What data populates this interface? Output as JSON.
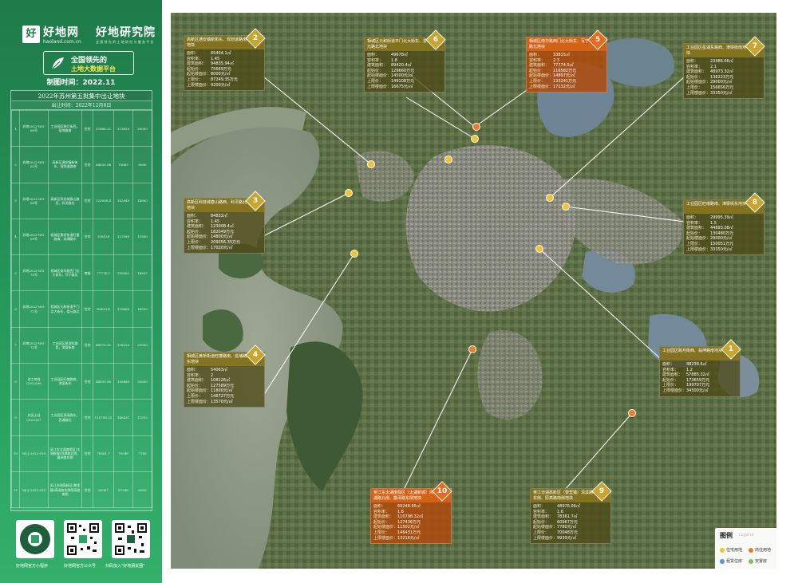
{
  "brand": {
    "logo_char": "好",
    "name": "好地网",
    "domain": "haoland.com.cn",
    "research": "好地研究院",
    "research_sub": "全 国 领 先 的 土 地 研 究 与 服 务 平 台"
  },
  "platform": {
    "line1": "全国领先的",
    "line2": "土地大数据平台"
  },
  "make_time": "制图时间：2022.11",
  "table": {
    "title": "2022年苏州第五批集中出让地块",
    "subtitle": "出让时间：2022年12月8日",
    "rows": [
      [
        "1",
        "苏地2022-WG-60号",
        "工业园区跨月街西，翁坤路南",
        "住宅",
        "57888.32",
        "173659",
        "30000"
      ],
      [
        "2",
        "苏地2022-WG-62号",
        "高新区通安镇新街东，规划道路南",
        "住宅",
        "84835.94",
        "75669",
        "8000"
      ],
      [
        "3",
        "苏地2022-WG-68号",
        "高新区科技城春山路西，科灵路北",
        "住宅",
        "123008.4",
        "182049",
        "14800"
      ],
      [
        "4",
        "苏地2022-WG-69号",
        "相城区黄桥街道旺蓬路南，巡埔路东",
        "住宅",
        "108126",
        "127589",
        "11800"
      ],
      [
        "5",
        "苏地2022-WG-70号",
        "相城区南华路西门北大街东，写宁路北",
        "商服",
        "77774.5",
        "116582",
        "14897"
      ],
      [
        "6",
        "苏地2022-WG-71号",
        "相城区元和街道平门北大街东，爱元路北",
        "住宅",
        "89420.4",
        "129660",
        "14500"
      ],
      [
        "7",
        "苏地2022-WG-72号",
        "工业园区星湖东路西，津梁街南",
        "住宅",
        "48973.32",
        "136223",
        "29000"
      ],
      [
        "8",
        "苏工地块(2022)06",
        "工业园区旺墩路南，津梁街东",
        "住宅",
        "44893.08",
        "130480",
        "30000"
      ],
      [
        "9",
        "苏吴土挂(2022)07",
        "工业园区扬清路东，西浦路北",
        "住宅",
        "110798.32",
        "146431",
        "11502"
      ],
      [
        "10",
        "WJ-J-2022-019",
        "吴江东太湖度假区(太湖新城)鸿湖路北侧，震泽路东侧",
        "住宅",
        "78361.7",
        "70048",
        "7780"
      ],
      [
        "11",
        "WJ-J-2022-018",
        "吴江汾湖高新区(黎里镇)清溪路东侧原高路南侧",
        "住宅",
        "60967",
        "87248",
        "8000"
      ]
    ]
  },
  "qr": [
    {
      "label": "好地网官方小程序"
    },
    {
      "label": "好地网官方公众号"
    },
    {
      "label": "扫码加入\"好地朋友圈\""
    }
  ],
  "parcels": [
    {
      "num": "1",
      "type": "residential",
      "title": "工业园区跨月街西、翁坤路南地块",
      "area": "48238.6㎡",
      "far": "1.2",
      "building": "57885.32㎡",
      "start_price": "173659万元",
      "cap_price": "199707万元",
      "cap_floor": "34500元/㎡"
    },
    {
      "num": "2",
      "type": "residential",
      "title": "高新区通安镇新街东、规划道路南地块",
      "area": "65404.1㎡",
      "far": "1.45",
      "building": "94835.94㎡",
      "start_price": "75669万元",
      "cap_price": "87249.35万元",
      "cap_floor": "9200元/㎡",
      "floor_price": "8000元/㎡"
    },
    {
      "num": "3",
      "type": "residential",
      "title": "高新区科技城春山路西、科灵路北地块",
      "area": "84832㎡",
      "far": "1.45",
      "building": "123008.4㎡",
      "start_price": "182049万元",
      "cap_price": "209356.35万元",
      "cap_floor": "17020元/㎡",
      "floor_price": "14800元/㎡"
    },
    {
      "num": "4",
      "type": "residential",
      "title": "相城区黄桥街道旺蓬路南、巡埔路东地块",
      "area": "54063㎡",
      "far": "2",
      "building": "108126㎡",
      "start_price": "127589万元",
      "cap_price": "146727万元",
      "cap_floor": "13570元/㎡",
      "floor_price": "11800元/㎡"
    },
    {
      "num": "5",
      "type": "commercial",
      "title": "相城区南华路西门北大街东、写宁路北地块",
      "area": "33815㎡",
      "far": "2.3",
      "building": "77774.5㎡",
      "start_price": "116582万元",
      "cap_price": "133241万元",
      "cap_floor": "17132元/㎡",
      "floor_price": "14897元/㎡"
    },
    {
      "num": "6",
      "type": "residential",
      "title": "相城区元和街道平门北大街东、爱元路北地块",
      "area": "49678㎡",
      "far": "1.8",
      "building": "89420.4㎡",
      "start_price": "129660万元",
      "cap_price": "149108万元",
      "cap_floor": "16675元/㎡",
      "floor_price": "14500元/㎡"
    },
    {
      "num": "7",
      "type": "residential",
      "title": "工业园区星湖东路西、津梁街南地块",
      "area": "23486.66㎡",
      "far": "2.1",
      "building": "48973.32㎡",
      "start_price": "136223万元",
      "cap_price": "156656万元",
      "cap_floor": "33350元/㎡",
      "floor_price": "29000元/㎡"
    },
    {
      "num": "8",
      "type": "residential",
      "title": "工业园区旺墩路南、津梁街东地块",
      "area": "29995.39㎡",
      "far": "1.5",
      "building": "44893.08㎡",
      "start_price": "130480万元",
      "cap_price": "150051万元",
      "cap_floor": "33350元/㎡",
      "floor_price": "29000元/㎡"
    },
    {
      "num": "9",
      "type": "residential",
      "title": "吴江汾湖高新区（黎里镇）清溪路东侧、原高路南侧地块",
      "area": "48976.06㎡",
      "far": "1.6",
      "building": "78361.7㎡",
      "start_price": "60967万元",
      "cap_price": "70048万元",
      "cap_floor": "9939元/㎡",
      "floor_price": "7780元/㎡"
    },
    {
      "num": "10",
      "type": "commercial",
      "title": "吴江东太湖度假区（太湖新城）鸿湖路北侧、震泽路东侧地块",
      "area": "69248.95㎡",
      "far": "1.6",
      "building": "110798.32㎡",
      "start_price": "127436万元",
      "cap_price": "146431万元",
      "cap_floor": "13216元/㎡",
      "floor_price": "11502元/㎡"
    }
  ],
  "field_labels": {
    "area": "面积：",
    "far": "容积率：",
    "building": "建筑面积：",
    "start_price": "起始价：",
    "floor_price": "起始楼面价：",
    "cap_price": "上限价：",
    "cap_floor": "上限楼面价："
  },
  "legend": {
    "title": "图例",
    "title_en": "Legend",
    "items": [
      {
        "label": "住宅用地",
        "color": "#f2c230"
      },
      {
        "label": "商住用地",
        "color": "#ee7b2a"
      },
      {
        "label": "租赁住房",
        "color": "#4e96d8"
      },
      {
        "label": "安置房",
        "color": "#7bc25c"
      }
    ]
  },
  "colors": {
    "residential": "#f2c230",
    "commercial": "#ee7b2a"
  }
}
